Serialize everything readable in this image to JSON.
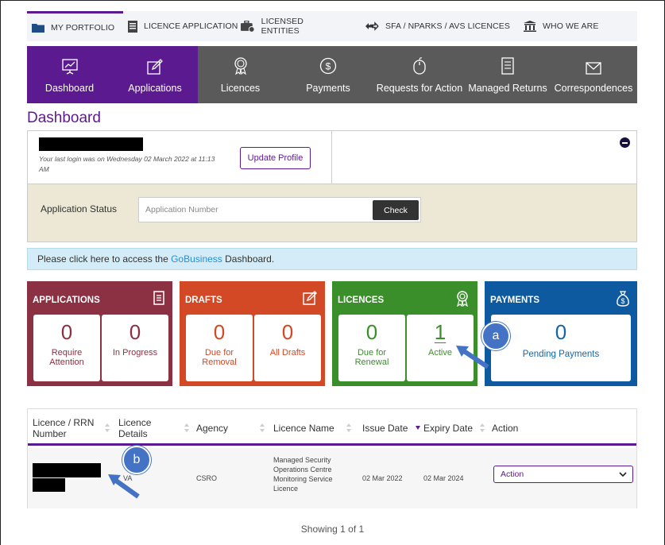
{
  "topnav": [
    {
      "label": "MY PORTFOLIO",
      "icon": "folder-icon",
      "active": true
    },
    {
      "label": "LICENCE APPLICATION",
      "icon": "document-icon"
    },
    {
      "label": "LICENSED ENTITIES",
      "icon": "briefcase-icon"
    },
    {
      "label": "SFA / NPARKS / AVS LICENCES",
      "icon": "exchange-icon"
    },
    {
      "label": "WHO WE ARE",
      "icon": "bank-icon"
    }
  ],
  "tabs": [
    {
      "label": "Dashboard",
      "icon": "dashboard-icon",
      "active": true
    },
    {
      "label": "Applications",
      "icon": "edit-icon",
      "active": true
    },
    {
      "label": "Licences",
      "icon": "award-icon"
    },
    {
      "label": "Payments",
      "icon": "dollar-icon"
    },
    {
      "label": "Requests for Action",
      "icon": "mouse-icon"
    },
    {
      "label": "Managed Returns",
      "icon": "file-list-icon"
    },
    {
      "label": "Correspondences",
      "icon": "envelope-icon"
    }
  ],
  "page_title": "Dashboard",
  "profile": {
    "last_login": "Your last login was on Wednesday 02 March 2022 at 11:13 AM",
    "update_button": "Update Profile"
  },
  "application_status": {
    "label": "Application Status",
    "placeholder": "Application Number",
    "check_button": "Check"
  },
  "banner": {
    "prefix": "Please click here to access the ",
    "link": "GoBusiness",
    "suffix": " Dashboard."
  },
  "cards": {
    "applications": {
      "title": "APPLICATIONS",
      "items": [
        {
          "value": "0",
          "label": "Require Attention"
        },
        {
          "value": "0",
          "label": "In Progress"
        }
      ]
    },
    "drafts": {
      "title": "DRAFTS",
      "items": [
        {
          "value": "0",
          "label": "Due for Removal"
        },
        {
          "value": "0",
          "label": "All Drafts"
        }
      ]
    },
    "licences": {
      "title": "LICENCES",
      "items": [
        {
          "value": "0",
          "label": "Due for Renewal"
        },
        {
          "value": "1",
          "label": "Active"
        }
      ]
    },
    "payments": {
      "title": "PAYMENTS",
      "items": [
        {
          "value": "0",
          "label": "Pending Payments"
        }
      ]
    }
  },
  "markers": {
    "a": "a",
    "b": "b"
  },
  "colors": {
    "brand_purple": "#5b1a8f",
    "applications": "#8c3043",
    "drafts": "#d34825",
    "licences": "#3b8f2a",
    "payments": "#0e5aa0"
  },
  "table": {
    "headers": [
      "Licence / RRN Number",
      "Licence Details",
      "Agency",
      "Licence Name",
      "Issue Date",
      "Expiry Date",
      "Action"
    ],
    "rows": [
      {
        "details": "VA",
        "agency": "CSRO",
        "licence_name": "Managed Security Operations Centre Monitoring Service Licence",
        "issue_date": "02 Mar 2022",
        "expiry_date": "02 Mar 2024",
        "action": "Action"
      }
    ]
  },
  "footer": {
    "showing": "Showing 1 of 1"
  }
}
